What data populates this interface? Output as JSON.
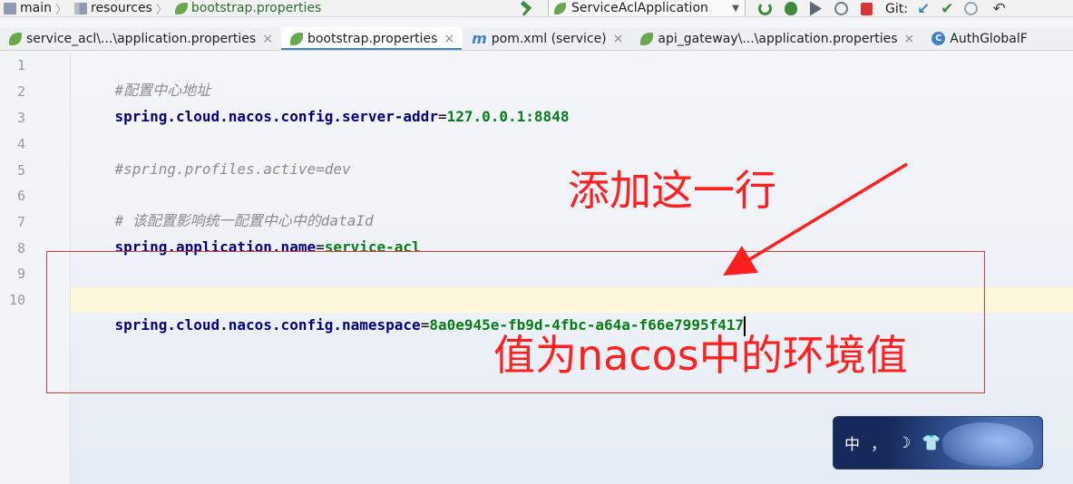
{
  "breadcrumbs": [
    "main",
    "resources",
    "bootstrap.properties"
  ],
  "toolbar": {
    "run_config": "ServiceAclApplication",
    "git_label": "Git:"
  },
  "tabs": [
    {
      "label": "service_acl\\...\\application.properties",
      "icon": "leaf-icon",
      "active": false
    },
    {
      "label": "bootstrap.properties",
      "icon": "leaf-icon",
      "active": true
    },
    {
      "label": "pom.xml (service)",
      "icon": "maven-icon",
      "active": false
    },
    {
      "label": "api_gateway\\...\\application.properties",
      "icon": "leaf-icon",
      "active": false
    },
    {
      "label": "AuthGlobalF",
      "icon": "class-icon",
      "active": false
    }
  ],
  "editor": {
    "current_line": 10,
    "lines": [
      {
        "n": "1",
        "comment": "#配置中心地址"
      },
      {
        "n": "2",
        "key": "spring.cloud.nacos.config.server-addr",
        "eq": "=",
        "value": "127.0.0.1:8848"
      },
      {
        "n": "3"
      },
      {
        "n": "4",
        "comment": "#spring.profiles.active=dev"
      },
      {
        "n": "5"
      },
      {
        "n": "6",
        "comment": "# 该配置影响统一配置中心中的dataId"
      },
      {
        "n": "7",
        "key": "spring.application.name",
        "eq": "=",
        "value": "service-acl"
      },
      {
        "n": "8"
      },
      {
        "n": "9"
      },
      {
        "n": "10",
        "key": "spring.cloud.nacos.config.namespace",
        "eq": "=",
        "value": "8a0e945e-fb9d-4fbc-a64a-f66e7995f417"
      }
    ]
  },
  "annotations": {
    "add_line": "添加这一行",
    "value_note": "值为nacos中的环境值",
    "color": "#ff1f1f"
  },
  "ime": {
    "mode": "中",
    "punct": "，",
    "icons": [
      "moon-icon",
      "shirt-icon"
    ]
  }
}
